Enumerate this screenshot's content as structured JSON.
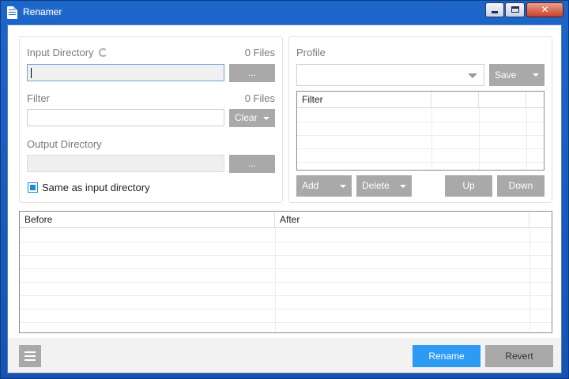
{
  "window": {
    "title": "Renamer"
  },
  "input_directory": {
    "label": "Input Directory",
    "file_count": "0 Files",
    "value": "",
    "browse_label": "..."
  },
  "filter": {
    "label": "Filter",
    "file_count": "0 Files",
    "value": "",
    "clear_label": "Clear"
  },
  "output_directory": {
    "label": "Output Directory",
    "value": "",
    "browse_label": "...",
    "same_as_input_label": "Same as input directory",
    "same_as_input_checked": true
  },
  "profile": {
    "label": "Profile",
    "selected": "",
    "save_label": "Save",
    "table_header": "Filter",
    "add_label": "Add",
    "delete_label": "Delete",
    "up_label": "Up",
    "down_label": "Down"
  },
  "preview": {
    "columns": [
      "Before",
      "After"
    ]
  },
  "footer": {
    "rename_label": "Rename",
    "revert_label": "Revert"
  },
  "colors": {
    "accent": "#2d9af3",
    "button_gray": "#a9a9a9",
    "titlebar": "#1d66c9",
    "checkbox": "#1e8ad2"
  }
}
